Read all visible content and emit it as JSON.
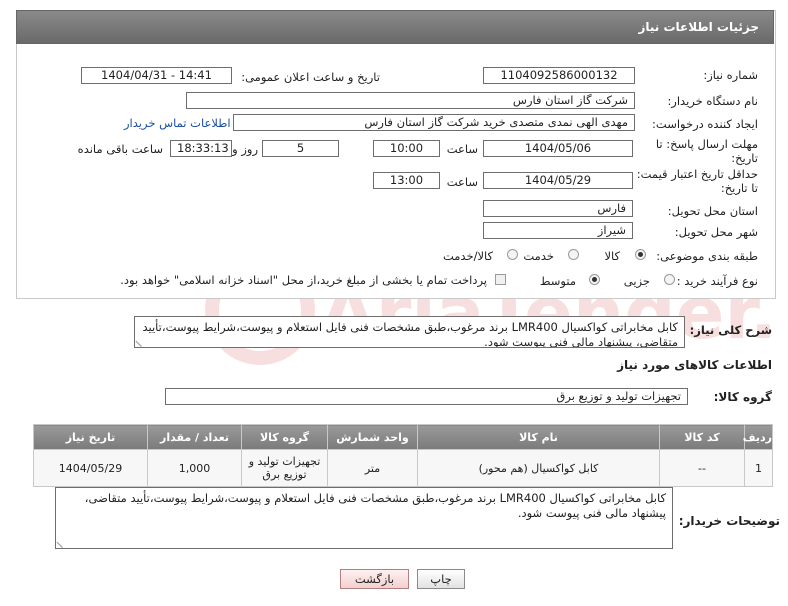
{
  "header": {
    "title": "جزئیات اطلاعات نیاز"
  },
  "form": {
    "need_number": {
      "label": "شماره نیاز:",
      "value": "1104092586000132"
    },
    "announce_datetime": {
      "label": "تاریخ و ساعت اعلان عمومی:",
      "value": "1404/04/31 - 14:41"
    },
    "buyer_org": {
      "label": "نام دستگاه خریدار:",
      "value": "شرکت گاز استان فارس"
    },
    "requester": {
      "label": "ایجاد کننده درخواست:",
      "value": "مهدی الهی نمدی متصدی خرید شرکت گاز استان فارس",
      "contact_link": "اطلاعات تماس خریدار"
    },
    "reply_deadline": {
      "label_line1": "مهلت ارسال پاسخ: تا",
      "label_line2": "تاریخ:",
      "date": "1404/05/06",
      "time_label": "ساعت",
      "time": "10:00",
      "days": "5",
      "days_label": "روز و",
      "remaining": "18:33:13",
      "remaining_label": "ساعت باقی مانده"
    },
    "price_validity": {
      "label_line1": "حداقل تاریخ اعتبار قیمت:",
      "label_line2": "تا تاریخ:",
      "date": "1404/05/29",
      "time_label": "ساعت",
      "time": "13:00"
    },
    "delivery_province": {
      "label": "استان محل تحویل:",
      "value": "فارس"
    },
    "delivery_city": {
      "label": "شهر محل تحویل:",
      "value": "شیراز"
    },
    "category": {
      "label": "طبقه بندی موضوعی:",
      "options": [
        "کالا",
        "خدمت",
        "کالا/خدمت"
      ],
      "selected": "کالا"
    },
    "purchase_type": {
      "label": "نوع فرآیند خرید :",
      "options": [
        "جزیی",
        "متوسط"
      ],
      "selected": "متوسط",
      "payment_note": "پرداخت تمام یا بخشی از مبلغ خرید،از محل \"اسناد خزانه اسلامی\" خواهد بود."
    }
  },
  "description": {
    "label": "شرح کلی نیاز:",
    "text": "کابل مخابراتی کواکسیال LMR400 برند مرغوب،طبق مشخصات فنی فایل استعلام و پیوست،شرایط پیوست،تأیید متقاضی، پیشنهاد مالی فنی پیوست شود."
  },
  "goods": {
    "section_title": "اطلاعات کالاهای مورد نیاز",
    "group_label": "گروه کالا:",
    "group_value": "تجهیزات تولید و توزیع برق",
    "columns": [
      "ردیف",
      "کد کالا",
      "نام کالا",
      "واحد شمارش",
      "گروه کالا",
      "تعداد / مقدار",
      "تاریخ نیاز"
    ],
    "rows": [
      [
        "1",
        "--",
        "کابل کواکسیال (هم محور)",
        "متر",
        "تجهیزات تولید و توزیع برق",
        "1,000",
        "1404/05/29"
      ]
    ]
  },
  "buyer_notes": {
    "label": "توضیحات خریدار:",
    "text": "کابل مخابراتی کواکسیال LMR400 برند مرغوب،طبق مشخصات فنی فایل استعلام و پیوست،شرایط پیوست،تأیید متقاضی، پیشنهاد مالی فنی پیوست شود."
  },
  "buttons": {
    "print": "چاپ",
    "back": "بازگشت"
  },
  "watermark": {
    "text": "AriaTender.neT"
  },
  "colors": {
    "header_bg": "#7a7a7a",
    "link": "#1a4fa0",
    "back_button": "#f4d0d0"
  }
}
